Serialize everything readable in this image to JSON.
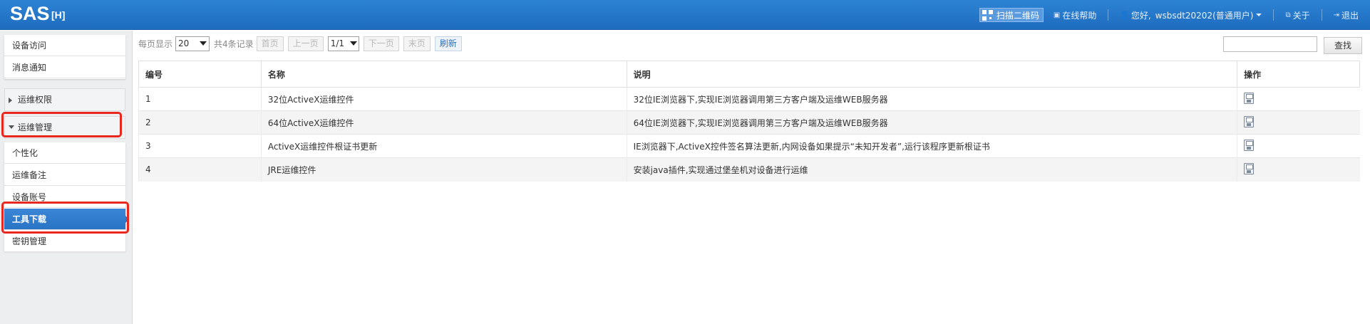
{
  "header": {
    "logo": "SAS",
    "logo_sub": "[H]",
    "scan_qr": "扫描二维码",
    "help": "在线帮助",
    "greeting": "您好,",
    "user": "wsbsdt20202(普通用户)",
    "about": "关于",
    "logout": "退出"
  },
  "sidebar": {
    "top_items": [
      "设备访问",
      "消息通知"
    ],
    "groups": [
      "运维权限",
      "运维管理"
    ],
    "sub_items": [
      "个性化",
      "运维备注",
      "设备账号",
      "工具下载",
      "密钥管理"
    ],
    "active_item": "工具下载"
  },
  "toolbar": {
    "per_page_label": "每页显示",
    "per_page_value": "20",
    "total_label": "共4条记录",
    "first": "首页",
    "prev": "上一页",
    "page_value": "1/1",
    "next": "下一页",
    "last": "末页",
    "refresh": "刷新",
    "search_value": "",
    "search_button": "查找"
  },
  "table": {
    "headers": [
      "编号",
      "名称",
      "说明",
      "操作"
    ],
    "rows": [
      {
        "id": "1",
        "name": "32位ActiveX运维控件",
        "desc": "32位IE浏览器下,实现IE浏览器调用第三方客户端及运维WEB服务器",
        "action": "save-icon"
      },
      {
        "id": "2",
        "name": "64位ActiveX运维控件",
        "desc": "64位IE浏览器下,实现IE浏览器调用第三方客户端及运维WEB服务器",
        "action": "save-icon"
      },
      {
        "id": "3",
        "name": "ActiveX运维控件根证书更新",
        "desc": "IE浏览器下,ActiveX控件签名算法更新,内网设备如果提示“未知开发者”,运行该程序更新根证书",
        "action": "save-icon"
      },
      {
        "id": "4",
        "name": "JRE运维控件",
        "desc": "安装java插件,实现通过堡垒机对设备进行运维",
        "action": "save-icon"
      }
    ]
  },
  "colors": {
    "header_bg": "#2478cb",
    "active_item": "#2a74c6",
    "highlight_box": "#e8271f"
  }
}
